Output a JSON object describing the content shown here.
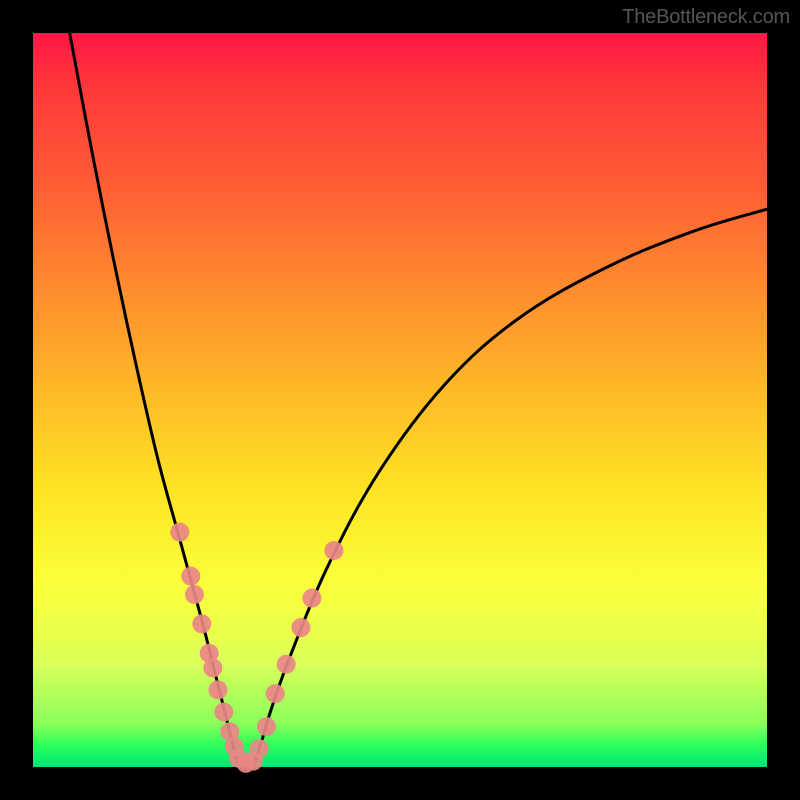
{
  "attribution": "TheBottleneck.com",
  "colors": {
    "frame": "#000000",
    "curve": "#000000",
    "marker": "#e98787",
    "gradient_top": "#ff1744",
    "gradient_mid": "#ffe324",
    "gradient_bottom": "#00e676"
  },
  "chart_data": {
    "type": "line",
    "title": "",
    "xlabel": "",
    "ylabel": "",
    "xlim": [
      0,
      100
    ],
    "ylim": [
      0,
      100
    ],
    "grid": false,
    "legend": false,
    "series": [
      {
        "name": "left-branch",
        "x": [
          5,
          8,
          11,
          14,
          17,
          20,
          23,
          25,
          26.5,
          27.5,
          28
        ],
        "y": [
          100,
          84,
          69,
          55,
          42,
          31,
          20,
          12,
          6,
          2,
          0
        ]
      },
      {
        "name": "right-branch",
        "x": [
          30,
          31,
          32.5,
          35,
          40,
          47,
          56,
          66,
          78,
          90,
          100
        ],
        "y": [
          0,
          3,
          8,
          15,
          27,
          40,
          52,
          61,
          68,
          73,
          76
        ]
      }
    ],
    "markers": [
      {
        "x": 20.0,
        "y": 32.0
      },
      {
        "x": 21.5,
        "y": 26.0
      },
      {
        "x": 22.0,
        "y": 23.5
      },
      {
        "x": 23.0,
        "y": 19.5
      },
      {
        "x": 24.0,
        "y": 15.5
      },
      {
        "x": 24.5,
        "y": 13.5
      },
      {
        "x": 25.2,
        "y": 10.5
      },
      {
        "x": 26.0,
        "y": 7.5
      },
      {
        "x": 26.8,
        "y": 4.8
      },
      {
        "x": 27.4,
        "y": 2.8
      },
      {
        "x": 28.0,
        "y": 1.2
      },
      {
        "x": 29.0,
        "y": 0.5
      },
      {
        "x": 30.0,
        "y": 0.8
      },
      {
        "x": 30.8,
        "y": 2.5
      },
      {
        "x": 31.8,
        "y": 5.5
      },
      {
        "x": 33.0,
        "y": 10.0
      },
      {
        "x": 34.5,
        "y": 14.0
      },
      {
        "x": 36.5,
        "y": 19.0
      },
      {
        "x": 38.0,
        "y": 23.0
      },
      {
        "x": 41.0,
        "y": 29.5
      }
    ]
  }
}
